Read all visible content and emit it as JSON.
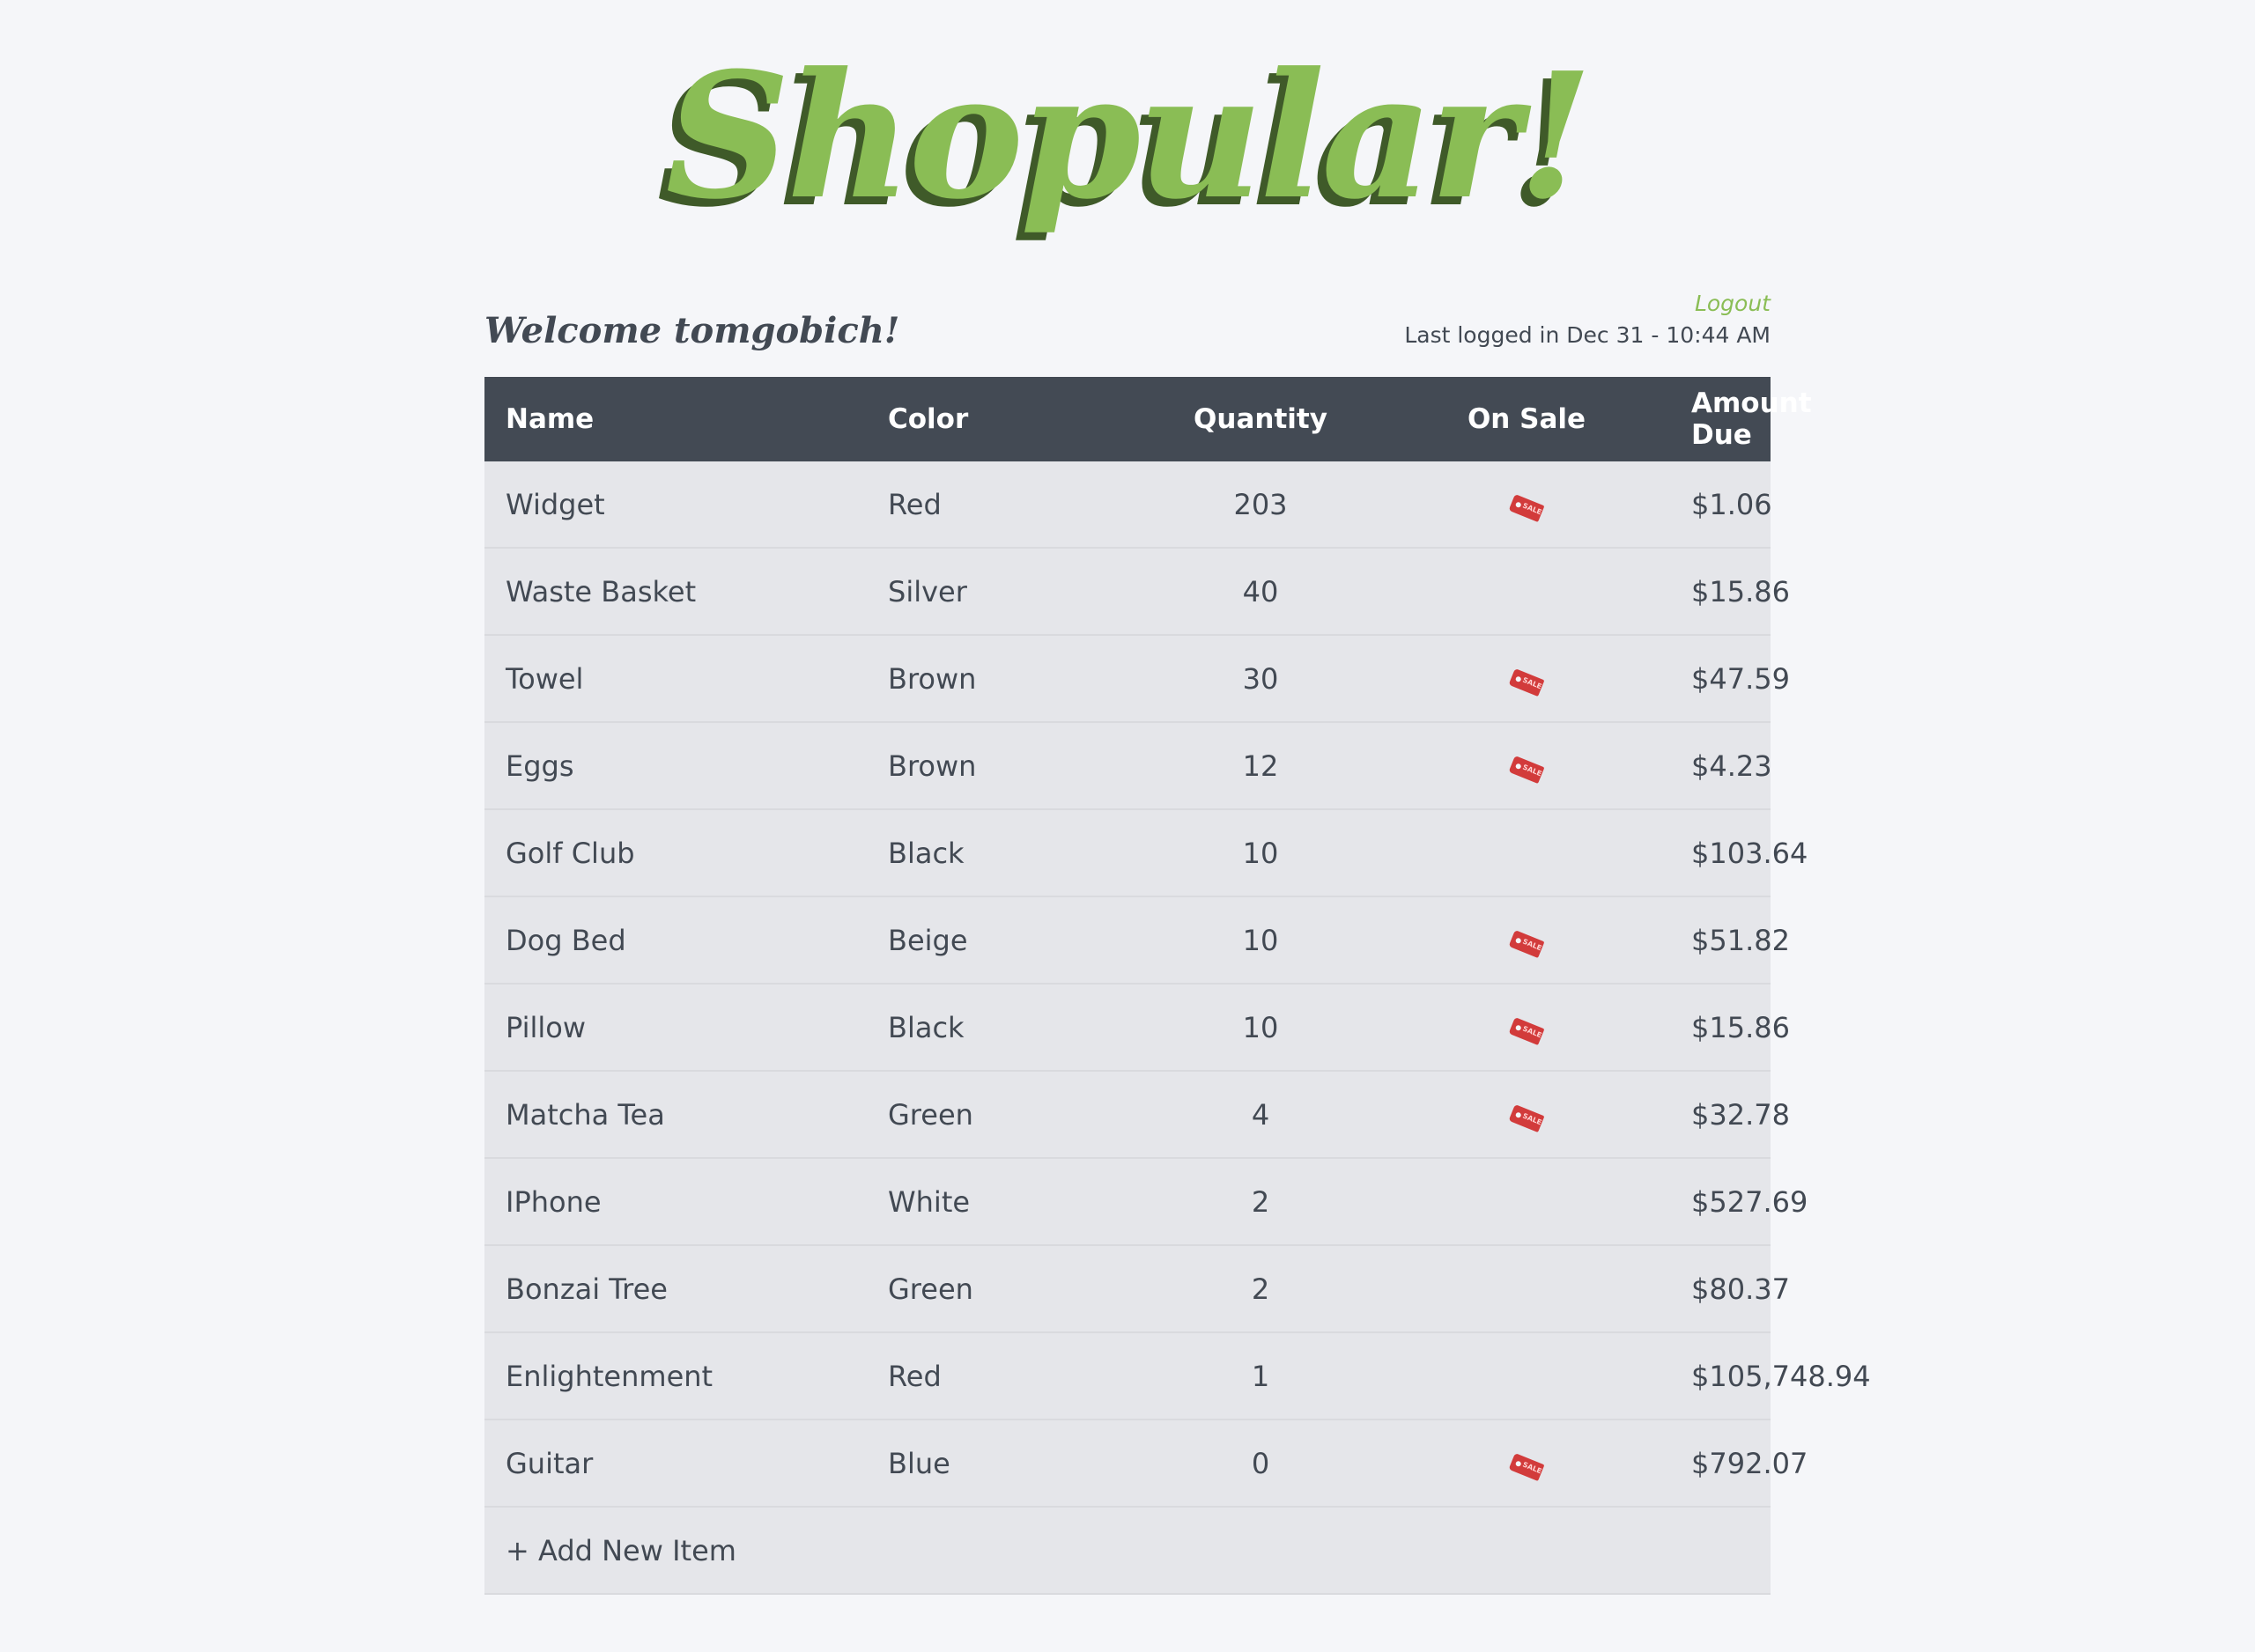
{
  "header": {
    "logo": "Shopular!",
    "welcome": "Welcome tomgobich!",
    "logout": "Logout",
    "last_login": "Last logged in Dec 31 - 10:44 AM"
  },
  "colors": {
    "brand_green": "#8abd55",
    "brand_shadow": "#3f5a29",
    "header_bg": "#434a54",
    "row_bg": "#e5e6ea",
    "page_bg": "#f5f6f9",
    "sale_tag": "#d23b3b"
  },
  "table": {
    "columns": [
      "Name",
      "Color",
      "Quantity",
      "On Sale",
      "Amount Due"
    ],
    "rows": [
      {
        "name": "Widget",
        "color": "Red",
        "quantity": "203",
        "on_sale": true,
        "amount": "$1.06"
      },
      {
        "name": "Waste Basket",
        "color": "Silver",
        "quantity": "40",
        "on_sale": false,
        "amount": "$15.86"
      },
      {
        "name": "Towel",
        "color": "Brown",
        "quantity": "30",
        "on_sale": true,
        "amount": "$47.59"
      },
      {
        "name": "Eggs",
        "color": "Brown",
        "quantity": "12",
        "on_sale": true,
        "amount": "$4.23"
      },
      {
        "name": "Golf Club",
        "color": "Black",
        "quantity": "10",
        "on_sale": false,
        "amount": "$103.64"
      },
      {
        "name": "Dog Bed",
        "color": "Beige",
        "quantity": "10",
        "on_sale": true,
        "amount": "$51.82"
      },
      {
        "name": "Pillow",
        "color": "Black",
        "quantity": "10",
        "on_sale": true,
        "amount": "$15.86"
      },
      {
        "name": "Matcha Tea",
        "color": "Green",
        "quantity": "4",
        "on_sale": true,
        "amount": "$32.78"
      },
      {
        "name": "IPhone",
        "color": "White",
        "quantity": "2",
        "on_sale": false,
        "amount": "$527.69"
      },
      {
        "name": "Bonzai Tree",
        "color": "Green",
        "quantity": "2",
        "on_sale": false,
        "amount": "$80.37"
      },
      {
        "name": "Enlightenment",
        "color": "Red",
        "quantity": "1",
        "on_sale": false,
        "amount": "$105,748.94"
      },
      {
        "name": "Guitar",
        "color": "Blue",
        "quantity": "0",
        "on_sale": true,
        "amount": "$792.07"
      }
    ],
    "add_item_label": "+ Add New Item",
    "sale_icon": "sale-tag-icon"
  }
}
